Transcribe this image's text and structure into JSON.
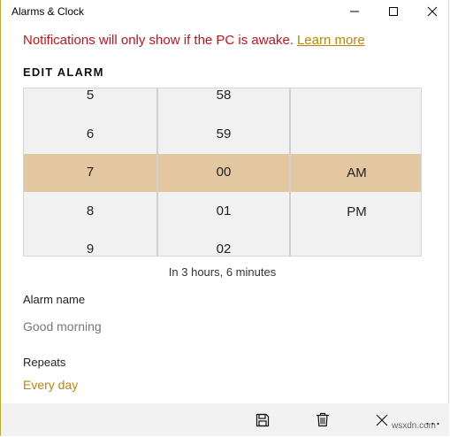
{
  "window": {
    "title": "Alarms & Clock"
  },
  "notice": {
    "text": "Notifications will only show if the PC is awake.",
    "link": "Learn more"
  },
  "edit": {
    "heading": "EDIT ALARM"
  },
  "picker": {
    "hours": [
      "5",
      "6",
      "7",
      "8",
      "9"
    ],
    "minutes": [
      "58",
      "59",
      "00",
      "01",
      "02"
    ],
    "periods": [
      "AM",
      "PM"
    ],
    "selected": {
      "hour": "7",
      "minute": "00",
      "period": "AM"
    },
    "highlight_color": "#e3c7a0"
  },
  "countdown": "In 3 hours, 6 minutes",
  "alarm_name": {
    "label": "Alarm name",
    "value": "Good morning"
  },
  "repeats": {
    "label": "Repeats",
    "value": "Every day"
  },
  "appbar": {
    "icons": [
      "save-icon",
      "delete-icon",
      "close-icon",
      "more-icon"
    ],
    "more": "..."
  },
  "watermark": "wsxdn.com",
  "colors": {
    "warning": "#c0151a",
    "accent": "#b8860b"
  }
}
